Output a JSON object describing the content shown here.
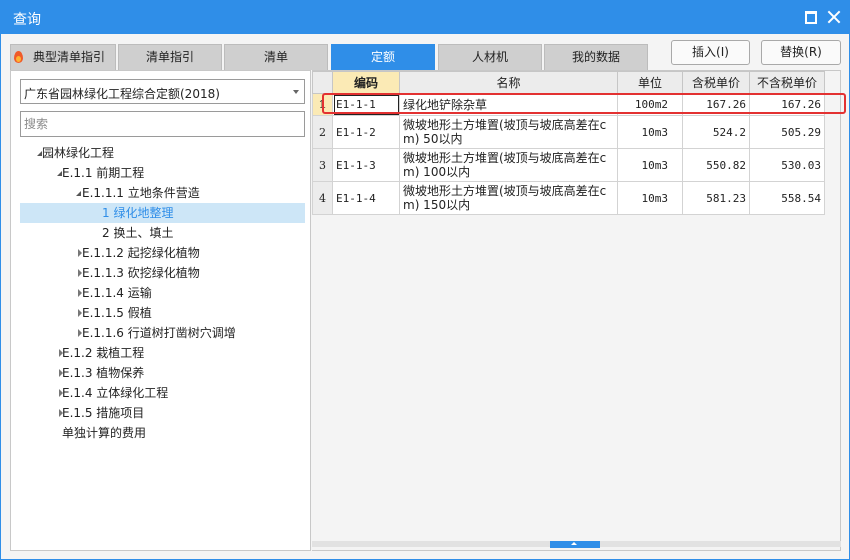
{
  "window": {
    "title": "查询"
  },
  "tabs": [
    {
      "label": "典型清单指引",
      "active": false
    },
    {
      "label": "清单指引",
      "active": false
    },
    {
      "label": "清单",
      "active": false
    },
    {
      "label": "定额",
      "active": true
    },
    {
      "label": "人材机",
      "active": false
    },
    {
      "label": "我的数据",
      "active": false
    }
  ],
  "actions": {
    "insert_label": "插入(I)",
    "replace_label": "替换(R)"
  },
  "left": {
    "library_select": "广东省园林绿化工程综合定额(2018)",
    "search_placeholder": "搜索",
    "tree": [
      {
        "label": "园林绿化工程",
        "level": 0,
        "state": "expanded"
      },
      {
        "label": "E.1.1 前期工程",
        "level": 1,
        "state": "expanded"
      },
      {
        "label": "E.1.1.1 立地条件营造",
        "level": 2,
        "state": "expanded"
      },
      {
        "label": "1 绿化地整理",
        "level": 3,
        "state": "leaf",
        "selected": true
      },
      {
        "label": "2 换土、填土",
        "level": 3,
        "state": "leaf"
      },
      {
        "label": "E.1.1.2 起挖绿化植物",
        "level": 2,
        "state": "collapsed"
      },
      {
        "label": "E.1.1.3 砍挖绿化植物",
        "level": 2,
        "state": "collapsed"
      },
      {
        "label": "E.1.1.4 运输",
        "level": 2,
        "state": "collapsed"
      },
      {
        "label": "E.1.1.5 假植",
        "level": 2,
        "state": "collapsed"
      },
      {
        "label": "E.1.1.6 行道树打凿树穴调增",
        "level": 2,
        "state": "collapsed"
      },
      {
        "label": "E.1.2 栽植工程",
        "level": 1,
        "state": "collapsed"
      },
      {
        "label": "E.1.3 植物保养",
        "level": 1,
        "state": "collapsed"
      },
      {
        "label": "E.1.4 立体绿化工程",
        "level": 1,
        "state": "collapsed"
      },
      {
        "label": "E.1.5 措施项目",
        "level": 1,
        "state": "collapsed"
      },
      {
        "label": "单独计算的费用",
        "level": 1,
        "state": "leaf"
      }
    ]
  },
  "grid": {
    "headers": [
      "",
      "编码",
      "名称",
      "单位",
      "含税单价",
      "不含税单价"
    ],
    "rows": [
      {
        "no": "1",
        "code": "E1-1-1",
        "name": "绿化地铲除杂草",
        "unit": "100m2",
        "price_tax": "167.26",
        "price_notax": "167.26"
      },
      {
        "no": "2",
        "code": "E1-1-2",
        "name": "微坡地形土方堆置(坡顶与坡底高差在cm) 50以内",
        "unit": "10m3",
        "price_tax": "524.2",
        "price_notax": "505.29"
      },
      {
        "no": "3",
        "code": "E1-1-3",
        "name": "微坡地形土方堆置(坡顶与坡底高差在cm) 100以内",
        "unit": "10m3",
        "price_tax": "550.82",
        "price_notax": "530.03"
      },
      {
        "no": "4",
        "code": "E1-1-4",
        "name": "微坡地形土方堆置(坡顶与坡底高差在cm) 150以内",
        "unit": "10m3",
        "price_tax": "581.23",
        "price_notax": "558.54"
      }
    ]
  },
  "colors": {
    "accent": "#2f8ee8",
    "selected_code_header": "#fbeab5",
    "highlight": "#e33131"
  }
}
